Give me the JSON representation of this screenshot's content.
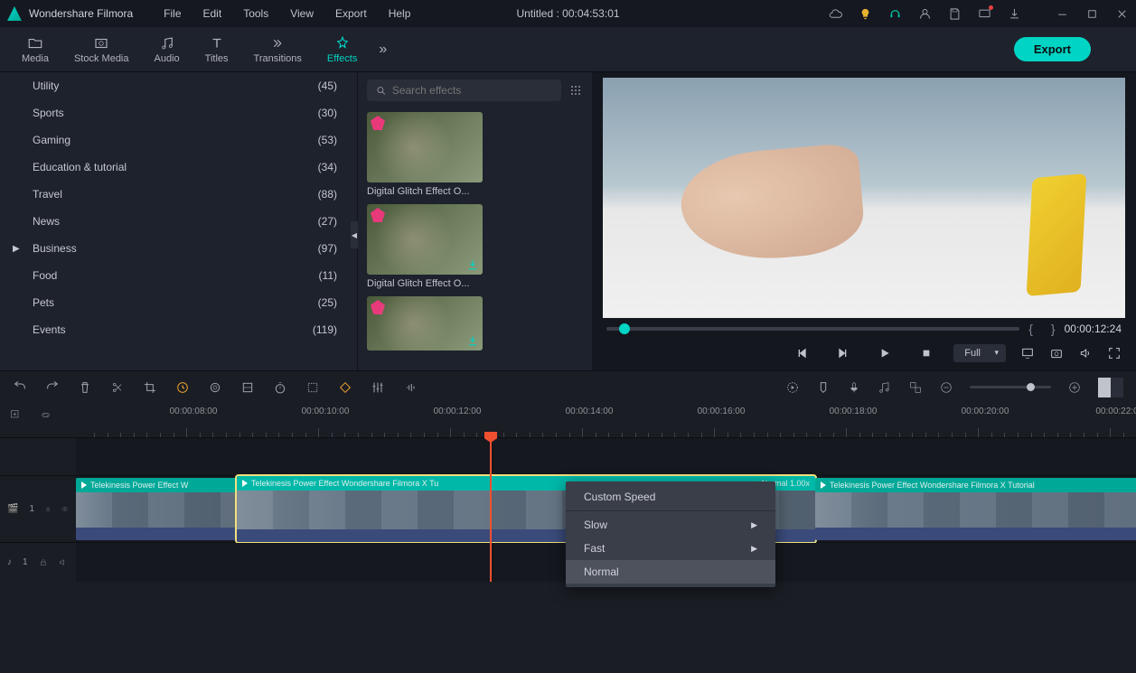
{
  "app": {
    "name": "Wondershare Filmora",
    "doc_title": "Untitled : 00:04:53:01"
  },
  "menu": [
    "File",
    "Edit",
    "Tools",
    "View",
    "Export",
    "Help"
  ],
  "tabs": {
    "items": [
      {
        "label": "Media"
      },
      {
        "label": "Stock Media"
      },
      {
        "label": "Audio"
      },
      {
        "label": "Titles"
      },
      {
        "label": "Transitions"
      },
      {
        "label": "Effects"
      }
    ],
    "active": 5,
    "export": "Export"
  },
  "categories": [
    {
      "name": "Utility",
      "count": "(45)"
    },
    {
      "name": "Sports",
      "count": "(30)"
    },
    {
      "name": "Gaming",
      "count": "(53)"
    },
    {
      "name": "Education & tutorial",
      "count": "(34)"
    },
    {
      "name": "Travel",
      "count": "(88)"
    },
    {
      "name": "News",
      "count": "(27)"
    },
    {
      "name": "Business",
      "count": "(97)",
      "has_sub": true
    },
    {
      "name": "Food",
      "count": "(11)"
    },
    {
      "name": "Pets",
      "count": "(25)"
    },
    {
      "name": "Events",
      "count": "(119)"
    }
  ],
  "search_placeholder": "Search effects",
  "effects": [
    {
      "label": "Digital Glitch Effect O..."
    },
    {
      "label": "Digital Glitch Effect O..."
    },
    {
      "label": ""
    }
  ],
  "preview": {
    "time": "00:00:12:24",
    "quality": "Full"
  },
  "ruler": [
    "00:00:08:00",
    "00:00:10:00",
    "00:00:12:00",
    "00:00:14:00",
    "00:00:16:00",
    "00:00:18:00",
    "00:00:20:00",
    "00:00:22:0"
  ],
  "tracks": {
    "video": "1",
    "audio": "1"
  },
  "clips": {
    "c1_text": "Telekinesis Power Effect  W",
    "c2_text": "Telekinesis Power Effect  Wondershare Filmora X  Tu",
    "c2_speed": "<< Normal 1.00x",
    "c3_text": "Telekinesis Power Effect  Wondershare Filmora X  Tutorial"
  },
  "context_menu": {
    "custom_speed": "Custom Speed",
    "slow": "Slow",
    "fast": "Fast",
    "normal": "Normal"
  }
}
